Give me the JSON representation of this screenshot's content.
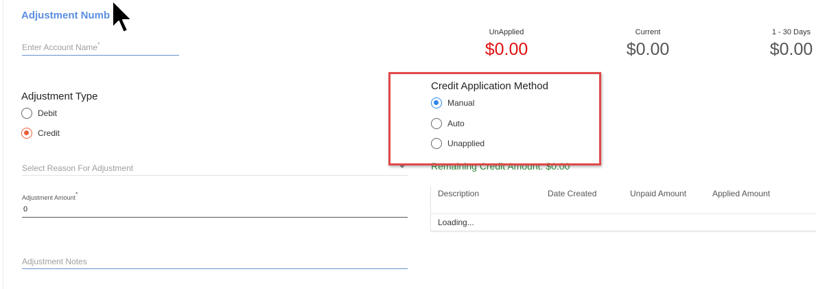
{
  "form": {
    "title": "Adjustment Numb",
    "account_name_placeholder": "Enter Account Name",
    "required_mark": "*",
    "adjustment_type_label": "Adjustment Type",
    "adjustment_types": [
      {
        "label": "Debit",
        "selected": false
      },
      {
        "label": "Credit",
        "selected": true
      }
    ],
    "reason_placeholder": "Select Reason For Adjustment",
    "amount_label": "Adjustment Amount",
    "amount_value": "0",
    "notes_placeholder": "Adjustment Notes"
  },
  "summary": {
    "unapplied_label": "UnApplied",
    "unapplied_value": "$0.00",
    "current_label": "Current",
    "current_value": "$0.00",
    "range_label": "1 - 30 Days",
    "range_value": "$0.00"
  },
  "credit_application": {
    "title": "Credit Application Method",
    "options": [
      {
        "label": "Manual",
        "selected": true
      },
      {
        "label": "Auto",
        "selected": false
      },
      {
        "label": "Unapplied",
        "selected": false
      }
    ],
    "remaining_text": "Remaining Credit Amount: $0.00"
  },
  "table": {
    "columns": [
      "Description",
      "Date Created",
      "Unpaid Amount",
      "Applied Amount"
    ],
    "loading_text": "Loading..."
  },
  "colors": {
    "title_blue": "#5b8ee0",
    "negative_red": "#e01010",
    "highlight_red": "#e04848",
    "radio_selected_orange": "#e8613a",
    "radio_selected_blue": "#2f86e8",
    "remaining_green": "#2e8b3a"
  },
  "icons": {
    "cursor": "mouse-pointer-icon",
    "dropdown": "caret-down-icon"
  }
}
